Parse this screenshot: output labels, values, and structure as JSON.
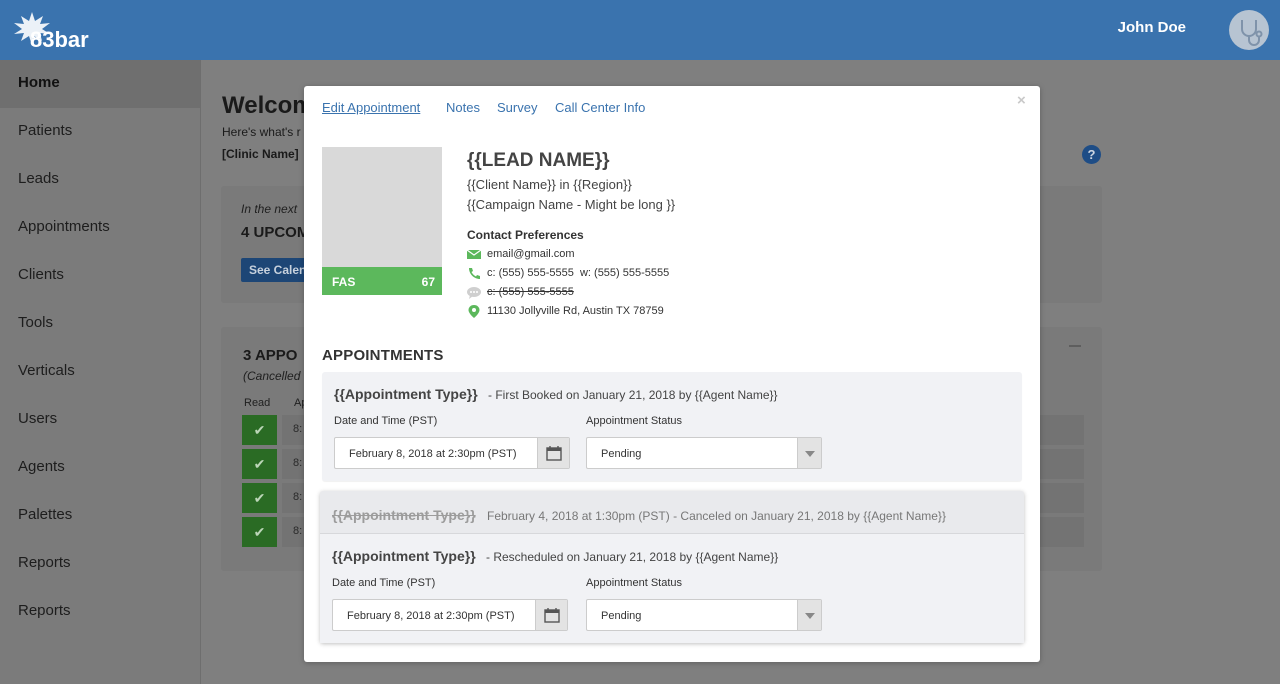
{
  "header": {
    "logo_text": "83bar",
    "user_name": "John Doe"
  },
  "sidebar": {
    "items": [
      {
        "label": "Home",
        "active": true
      },
      {
        "label": "Patients"
      },
      {
        "label": "Leads"
      },
      {
        "label": "Appointments"
      },
      {
        "label": "Clients"
      },
      {
        "label": "Tools"
      },
      {
        "label": "Verticals"
      },
      {
        "label": "Users"
      },
      {
        "label": "Agents"
      },
      {
        "label": "Palettes"
      },
      {
        "label": "Reports"
      },
      {
        "label": "Reports"
      }
    ]
  },
  "background": {
    "title": "Welcom",
    "subtitle": "Here's what's r",
    "clinic": "[Clinic Name]",
    "upcoming_intro": "In the next",
    "upcoming_title": "4 UPCOM",
    "see_calendar": "See Calen",
    "appointments_title": "3 APPO",
    "cancelled_note": "(Cancelled",
    "read_header": "Read",
    "appt_header": "Ap",
    "rows": [
      "8:",
      "8:",
      "8:",
      "8:"
    ]
  },
  "modal": {
    "tabs": [
      "Edit Appointment",
      "Notes",
      "Survey",
      "Call Center Info"
    ],
    "close": "×",
    "score_label": "FAS",
    "score_value": "67",
    "lead_name": "{{LEAD NAME}}",
    "client_line": "{{Client Name}} in {{Region}}",
    "campaign_line": "{{Campaign Name - Might be long }}",
    "contact_title": "Contact Preferences",
    "email": "email@gmail.com",
    "phone_c": "c: (555) 555-5555",
    "phone_w": "w: (555) 555-5555",
    "sms": "c: (555) 555-5555",
    "address": "11130 Jollyville Rd, Austin TX 78759",
    "appointments_heading": "APPOINTMENTS",
    "appointment1": {
      "type": "{{Appointment Type}}",
      "meta": "- First Booked on January 21, 2018 by {{Agent Name}}",
      "date_label": "Date and Time (PST)",
      "date_value": "February 8, 2018 at 2:30pm (PST)",
      "status_label": "Appointment Status",
      "status_value": "Pending"
    },
    "appointment_canceled": {
      "type": "{{Appointment Type}}",
      "meta": "February 4, 2018 at 1:30pm (PST) - Canceled on January 21, 2018 by {{Agent Name}}"
    },
    "appointment2": {
      "type": "{{Appointment Type}}",
      "meta": "- Rescheduled on January 21, 2018 by {{Agent Name}}",
      "date_label": "Date and Time (PST)",
      "date_value": "February 8, 2018 at 2:30pm (PST)",
      "status_label": "Appointment Status",
      "status_value": "Pending"
    }
  },
  "colors": {
    "brand_blue": "#3a73ae",
    "success_green": "#5cb85c"
  }
}
